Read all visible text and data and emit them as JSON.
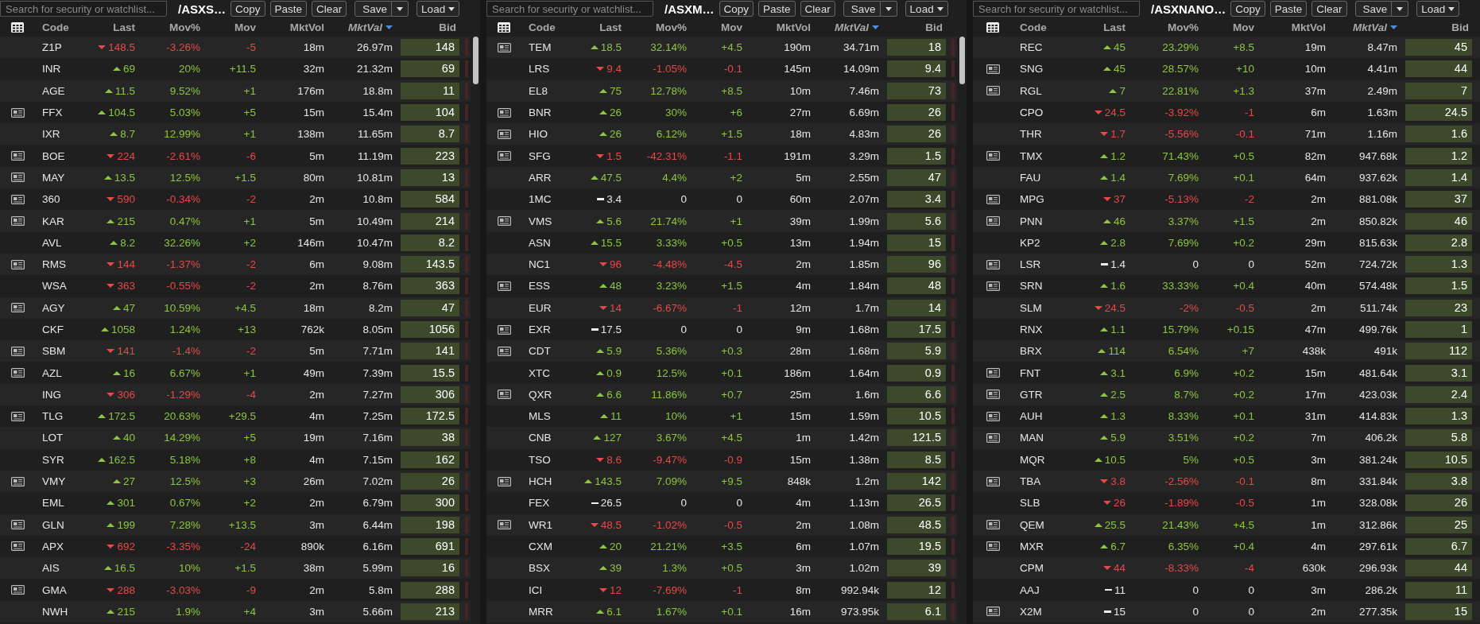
{
  "panels": [
    {
      "search": {
        "placeholder": "Search for security or watchlist..."
      },
      "title": "/ASXS…",
      "buttons": [
        {
          "label": "Copy",
          "kind": "plain"
        },
        {
          "label": "Paste",
          "kind": "plain"
        },
        {
          "label": "Clear",
          "kind": "plain"
        },
        {
          "label": "Save",
          "kind": "split"
        },
        {
          "label": "Load",
          "kind": "menu"
        }
      ],
      "columns": [
        {
          "label": "Code",
          "sorted": false
        },
        {
          "label": "Last",
          "sorted": false
        },
        {
          "label": "Mov%",
          "sorted": false
        },
        {
          "label": "Mov",
          "sorted": false
        },
        {
          "label": "MktVol",
          "sorted": false
        },
        {
          "label": "MktVal",
          "sorted": true
        },
        {
          "label": "Bid",
          "sorted": false
        }
      ],
      "rows": [
        {
          "news": false,
          "code": "Z1P",
          "last": "148.5",
          "kind": "down",
          "movpct": "-3.26%",
          "mov": "-5",
          "vol": "18m",
          "val": "26.97m",
          "bid": "148"
        },
        {
          "news": false,
          "code": "INR",
          "last": "69",
          "kind": "up",
          "movpct": "20%",
          "mov": "+11.5",
          "vol": "32m",
          "val": "21.32m",
          "bid": "69"
        },
        {
          "news": false,
          "code": "AGE",
          "last": "11.5",
          "kind": "up",
          "movpct": "9.52%",
          "mov": "+1",
          "vol": "176m",
          "val": "18.8m",
          "bid": "11"
        },
        {
          "news": true,
          "code": "FFX",
          "last": "104.5",
          "kind": "up",
          "movpct": "5.03%",
          "mov": "+5",
          "vol": "15m",
          "val": "15.4m",
          "bid": "104"
        },
        {
          "news": false,
          "code": "IXR",
          "last": "8.7",
          "kind": "up",
          "movpct": "12.99%",
          "mov": "+1",
          "vol": "138m",
          "val": "11.65m",
          "bid": "8.7"
        },
        {
          "news": true,
          "code": "BOE",
          "last": "224",
          "kind": "down",
          "movpct": "-2.61%",
          "mov": "-6",
          "vol": "5m",
          "val": "11.19m",
          "bid": "223"
        },
        {
          "news": true,
          "code": "MAY",
          "last": "13.5",
          "kind": "up",
          "movpct": "12.5%",
          "mov": "+1.5",
          "vol": "80m",
          "val": "10.81m",
          "bid": "13"
        },
        {
          "news": true,
          "code": "360",
          "last": "590",
          "kind": "down",
          "movpct": "-0.34%",
          "mov": "-2",
          "vol": "2m",
          "val": "10.8m",
          "bid": "584"
        },
        {
          "news": true,
          "code": "KAR",
          "last": "215",
          "kind": "up",
          "movpct": "0.47%",
          "mov": "+1",
          "vol": "5m",
          "val": "10.49m",
          "bid": "214"
        },
        {
          "news": false,
          "code": "AVL",
          "last": "8.2",
          "kind": "up",
          "movpct": "32.26%",
          "mov": "+2",
          "vol": "146m",
          "val": "10.47m",
          "bid": "8.2"
        },
        {
          "news": true,
          "code": "RMS",
          "last": "144",
          "kind": "down",
          "movpct": "-1.37%",
          "mov": "-2",
          "vol": "6m",
          "val": "9.08m",
          "bid": "143.5"
        },
        {
          "news": false,
          "code": "WSA",
          "last": "363",
          "kind": "down",
          "movpct": "-0.55%",
          "mov": "-2",
          "vol": "2m",
          "val": "8.76m",
          "bid": "363"
        },
        {
          "news": true,
          "code": "AGY",
          "last": "47",
          "kind": "up",
          "movpct": "10.59%",
          "mov": "+4.5",
          "vol": "18m",
          "val": "8.2m",
          "bid": "47"
        },
        {
          "news": false,
          "code": "CKF",
          "last": "1058",
          "kind": "up",
          "movpct": "1.24%",
          "mov": "+13",
          "vol": "762k",
          "val": "8.05m",
          "bid": "1056"
        },
        {
          "news": true,
          "code": "SBM",
          "last": "141",
          "kind": "down",
          "movpct": "-1.4%",
          "mov": "-2",
          "vol": "5m",
          "val": "7.71m",
          "bid": "141"
        },
        {
          "news": true,
          "code": "AZL",
          "last": "16",
          "kind": "up",
          "movpct": "6.67%",
          "mov": "+1",
          "vol": "49m",
          "val": "7.39m",
          "bid": "15.5"
        },
        {
          "news": false,
          "code": "ING",
          "last": "306",
          "kind": "down",
          "movpct": "-1.29%",
          "mov": "-4",
          "vol": "2m",
          "val": "7.27m",
          "bid": "306"
        },
        {
          "news": true,
          "code": "TLG",
          "last": "172.5",
          "kind": "up",
          "movpct": "20.63%",
          "mov": "+29.5",
          "vol": "4m",
          "val": "7.25m",
          "bid": "172.5"
        },
        {
          "news": false,
          "code": "LOT",
          "last": "40",
          "kind": "up",
          "movpct": "14.29%",
          "mov": "+5",
          "vol": "19m",
          "val": "7.16m",
          "bid": "38"
        },
        {
          "news": false,
          "code": "SYR",
          "last": "162.5",
          "kind": "up",
          "movpct": "5.18%",
          "mov": "+8",
          "vol": "4m",
          "val": "7.15m",
          "bid": "162"
        },
        {
          "news": true,
          "code": "VMY",
          "last": "27",
          "kind": "up",
          "movpct": "12.5%",
          "mov": "+3",
          "vol": "26m",
          "val": "7.02m",
          "bid": "26"
        },
        {
          "news": false,
          "code": "EML",
          "last": "301",
          "kind": "up",
          "movpct": "0.67%",
          "mov": "+2",
          "vol": "2m",
          "val": "6.79m",
          "bid": "300"
        },
        {
          "news": true,
          "code": "GLN",
          "last": "199",
          "kind": "up",
          "movpct": "7.28%",
          "mov": "+13.5",
          "vol": "3m",
          "val": "6.44m",
          "bid": "198"
        },
        {
          "news": true,
          "code": "APX",
          "last": "692",
          "kind": "down",
          "movpct": "-3.35%",
          "mov": "-24",
          "vol": "890k",
          "val": "6.16m",
          "bid": "691"
        },
        {
          "news": false,
          "code": "AIS",
          "last": "16.5",
          "kind": "up",
          "movpct": "10%",
          "mov": "+1.5",
          "vol": "38m",
          "val": "5.99m",
          "bid": "16"
        },
        {
          "news": true,
          "code": "GMA",
          "last": "288",
          "kind": "down",
          "movpct": "-3.03%",
          "mov": "-9",
          "vol": "2m",
          "val": "5.8m",
          "bid": "288"
        },
        {
          "news": false,
          "code": "NWH",
          "last": "215",
          "kind": "up",
          "movpct": "1.9%",
          "mov": "+4",
          "vol": "3m",
          "val": "5.66m",
          "bid": "213"
        }
      ]
    },
    {
      "search": {
        "placeholder": "Search for security or watchlist..."
      },
      "title": "/ASXM…",
      "buttons": [
        {
          "label": "Copy",
          "kind": "plain"
        },
        {
          "label": "Paste",
          "kind": "plain"
        },
        {
          "label": "Clear",
          "kind": "plain"
        },
        {
          "label": "Save",
          "kind": "split"
        },
        {
          "label": "Load",
          "kind": "menu"
        }
      ],
      "columns": [
        {
          "label": "Code",
          "sorted": false
        },
        {
          "label": "Last",
          "sorted": false
        },
        {
          "label": "Mov%",
          "sorted": false
        },
        {
          "label": "Mov",
          "sorted": false
        },
        {
          "label": "MktVol",
          "sorted": false
        },
        {
          "label": "MktVal",
          "sorted": true
        },
        {
          "label": "Bid",
          "sorted": false
        }
      ],
      "rows": [
        {
          "news": true,
          "code": "TEM",
          "last": "18.5",
          "kind": "up",
          "movpct": "32.14%",
          "mov": "+4.5",
          "vol": "190m",
          "val": "34.71m",
          "bid": "18"
        },
        {
          "news": false,
          "code": "LRS",
          "last": "9.4",
          "kind": "down",
          "movpct": "-1.05%",
          "mov": "-0.1",
          "vol": "145m",
          "val": "14.09m",
          "bid": "9.4"
        },
        {
          "news": false,
          "code": "EL8",
          "last": "75",
          "kind": "up",
          "movpct": "12.78%",
          "mov": "+8.5",
          "vol": "10m",
          "val": "7.46m",
          "bid": "73"
        },
        {
          "news": true,
          "code": "BNR",
          "last": "26",
          "kind": "up",
          "movpct": "30%",
          "mov": "+6",
          "vol": "27m",
          "val": "6.69m",
          "bid": "26"
        },
        {
          "news": true,
          "code": "HIO",
          "last": "26",
          "kind": "up",
          "movpct": "6.12%",
          "mov": "+1.5",
          "vol": "18m",
          "val": "4.83m",
          "bid": "26"
        },
        {
          "news": true,
          "code": "SFG",
          "last": "1.5",
          "kind": "down",
          "movpct": "-42.31%",
          "mov": "-1.1",
          "vol": "191m",
          "val": "3.29m",
          "bid": "1.5"
        },
        {
          "news": false,
          "code": "ARR",
          "last": "47.5",
          "kind": "up",
          "movpct": "4.4%",
          "mov": "+2",
          "vol": "5m",
          "val": "2.55m",
          "bid": "47"
        },
        {
          "news": false,
          "code": "1MC",
          "last": "3.4",
          "kind": "flat",
          "movpct": "0",
          "mov": "0",
          "vol": "60m",
          "val": "2.07m",
          "bid": "3.4"
        },
        {
          "news": true,
          "code": "VMS",
          "last": "5.6",
          "kind": "up",
          "movpct": "21.74%",
          "mov": "+1",
          "vol": "39m",
          "val": "1.99m",
          "bid": "5.6"
        },
        {
          "news": false,
          "code": "ASN",
          "last": "15.5",
          "kind": "up",
          "movpct": "3.33%",
          "mov": "+0.5",
          "vol": "13m",
          "val": "1.94m",
          "bid": "15"
        },
        {
          "news": false,
          "code": "NC1",
          "last": "96",
          "kind": "down",
          "movpct": "-4.48%",
          "mov": "-4.5",
          "vol": "2m",
          "val": "1.85m",
          "bid": "96"
        },
        {
          "news": true,
          "code": "ESS",
          "last": "48",
          "kind": "up",
          "movpct": "3.23%",
          "mov": "+1.5",
          "vol": "4m",
          "val": "1.84m",
          "bid": "48"
        },
        {
          "news": false,
          "code": "EUR",
          "last": "14",
          "kind": "down",
          "movpct": "-6.67%",
          "mov": "-1",
          "vol": "12m",
          "val": "1.7m",
          "bid": "14"
        },
        {
          "news": true,
          "code": "EXR",
          "last": "17.5",
          "kind": "flat",
          "movpct": "0",
          "mov": "0",
          "vol": "9m",
          "val": "1.68m",
          "bid": "17.5"
        },
        {
          "news": true,
          "code": "CDT",
          "last": "5.9",
          "kind": "up",
          "movpct": "5.36%",
          "mov": "+0.3",
          "vol": "28m",
          "val": "1.68m",
          "bid": "5.9"
        },
        {
          "news": false,
          "code": "XTC",
          "last": "0.9",
          "kind": "up",
          "movpct": "12.5%",
          "mov": "+0.1",
          "vol": "186m",
          "val": "1.64m",
          "bid": "0.9"
        },
        {
          "news": true,
          "code": "QXR",
          "last": "6.6",
          "kind": "up",
          "movpct": "11.86%",
          "mov": "+0.7",
          "vol": "25m",
          "val": "1.6m",
          "bid": "6.6"
        },
        {
          "news": false,
          "code": "MLS",
          "last": "11",
          "kind": "up",
          "movpct": "10%",
          "mov": "+1",
          "vol": "15m",
          "val": "1.59m",
          "bid": "10.5"
        },
        {
          "news": false,
          "code": "CNB",
          "last": "127",
          "kind": "up",
          "movpct": "3.67%",
          "mov": "+4.5",
          "vol": "1m",
          "val": "1.42m",
          "bid": "121.5"
        },
        {
          "news": false,
          "code": "TSO",
          "last": "8.6",
          "kind": "down",
          "movpct": "-9.47%",
          "mov": "-0.9",
          "vol": "15m",
          "val": "1.38m",
          "bid": "8.5"
        },
        {
          "news": true,
          "code": "HCH",
          "last": "143.5",
          "kind": "up",
          "movpct": "7.09%",
          "mov": "+9.5",
          "vol": "848k",
          "val": "1.2m",
          "bid": "142"
        },
        {
          "news": false,
          "code": "FEX",
          "last": "26.5",
          "kind": "flat",
          "movpct": "0",
          "mov": "0",
          "vol": "4m",
          "val": "1.13m",
          "bid": "26.5"
        },
        {
          "news": true,
          "code": "WR1",
          "last": "48.5",
          "kind": "down",
          "movpct": "-1.02%",
          "mov": "-0.5",
          "vol": "2m",
          "val": "1.08m",
          "bid": "48.5"
        },
        {
          "news": false,
          "code": "CXM",
          "last": "20",
          "kind": "up",
          "movpct": "21.21%",
          "mov": "+3.5",
          "vol": "6m",
          "val": "1.07m",
          "bid": "19.5"
        },
        {
          "news": false,
          "code": "BSX",
          "last": "39",
          "kind": "up",
          "movpct": "1.3%",
          "mov": "+0.5",
          "vol": "3m",
          "val": "1.02m",
          "bid": "39"
        },
        {
          "news": false,
          "code": "ICI",
          "last": "12",
          "kind": "down",
          "movpct": "-7.69%",
          "mov": "-1",
          "vol": "8m",
          "val": "992.94k",
          "bid": "12"
        },
        {
          "news": false,
          "code": "MRR",
          "last": "6.1",
          "kind": "up",
          "movpct": "1.67%",
          "mov": "+0.1",
          "vol": "16m",
          "val": "973.95k",
          "bid": "6.1"
        }
      ]
    },
    {
      "search": {
        "placeholder": "Search for security or watchlist..."
      },
      "title": "/ASXNANO…",
      "buttons": [
        {
          "label": "Copy",
          "kind": "plain"
        },
        {
          "label": "Paste",
          "kind": "plain"
        },
        {
          "label": "Clear",
          "kind": "plain"
        },
        {
          "label": "Save",
          "kind": "split"
        },
        {
          "label": "Load",
          "kind": "menu"
        }
      ],
      "columns": [
        {
          "label": "Code",
          "sorted": false
        },
        {
          "label": "Last",
          "sorted": false
        },
        {
          "label": "Mov%",
          "sorted": false
        },
        {
          "label": "Mov",
          "sorted": false
        },
        {
          "label": "MktVol",
          "sorted": false
        },
        {
          "label": "MktVal",
          "sorted": true
        },
        {
          "label": "Bid",
          "sorted": false
        }
      ],
      "rows": [
        {
          "news": false,
          "code": "REC",
          "last": "45",
          "kind": "up",
          "movpct": "23.29%",
          "mov": "+8.5",
          "vol": "19m",
          "val": "8.47m",
          "bid": "45"
        },
        {
          "news": true,
          "code": "SNG",
          "last": "45",
          "kind": "up",
          "movpct": "28.57%",
          "mov": "+10",
          "vol": "10m",
          "val": "4.41m",
          "bid": "44"
        },
        {
          "news": true,
          "code": "RGL",
          "last": "7",
          "kind": "up",
          "movpct": "22.81%",
          "mov": "+1.3",
          "vol": "37m",
          "val": "2.49m",
          "bid": "7"
        },
        {
          "news": false,
          "code": "CPO",
          "last": "24.5",
          "kind": "down",
          "movpct": "-3.92%",
          "mov": "-1",
          "vol": "6m",
          "val": "1.63m",
          "bid": "24.5"
        },
        {
          "news": false,
          "code": "THR",
          "last": "1.7",
          "kind": "down",
          "movpct": "-5.56%",
          "mov": "-0.1",
          "vol": "71m",
          "val": "1.16m",
          "bid": "1.6"
        },
        {
          "news": true,
          "code": "TMX",
          "last": "1.2",
          "kind": "up",
          "movpct": "71.43%",
          "mov": "+0.5",
          "vol": "82m",
          "val": "947.68k",
          "bid": "1.2"
        },
        {
          "news": false,
          "code": "FAU",
          "last": "1.4",
          "kind": "up",
          "movpct": "7.69%",
          "mov": "+0.1",
          "vol": "64m",
          "val": "937.62k",
          "bid": "1.4"
        },
        {
          "news": true,
          "code": "MPG",
          "last": "37",
          "kind": "down",
          "movpct": "-5.13%",
          "mov": "-2",
          "vol": "2m",
          "val": "881.08k",
          "bid": "37"
        },
        {
          "news": true,
          "code": "PNN",
          "last": "46",
          "kind": "up",
          "movpct": "3.37%",
          "mov": "+1.5",
          "vol": "2m",
          "val": "850.82k",
          "bid": "46"
        },
        {
          "news": false,
          "code": "KP2",
          "last": "2.8",
          "kind": "up",
          "movpct": "7.69%",
          "mov": "+0.2",
          "vol": "29m",
          "val": "815.63k",
          "bid": "2.8"
        },
        {
          "news": true,
          "code": "LSR",
          "last": "1.4",
          "kind": "flat",
          "movpct": "0",
          "mov": "0",
          "vol": "52m",
          "val": "724.72k",
          "bid": "1.3"
        },
        {
          "news": true,
          "code": "SRN",
          "last": "1.6",
          "kind": "up",
          "movpct": "33.33%",
          "mov": "+0.4",
          "vol": "40m",
          "val": "574.48k",
          "bid": "1.5"
        },
        {
          "news": false,
          "code": "SLM",
          "last": "24.5",
          "kind": "down",
          "movpct": "-2%",
          "mov": "-0.5",
          "vol": "2m",
          "val": "511.74k",
          "bid": "23"
        },
        {
          "news": false,
          "code": "RNX",
          "last": "1.1",
          "kind": "up",
          "movpct": "15.79%",
          "mov": "+0.15",
          "vol": "47m",
          "val": "499.76k",
          "bid": "1"
        },
        {
          "news": false,
          "code": "BRX",
          "last": "114",
          "kind": "up",
          "movpct": "6.54%",
          "mov": "+7",
          "vol": "438k",
          "val": "491k",
          "bid": "112"
        },
        {
          "news": true,
          "code": "FNT",
          "last": "3.1",
          "kind": "up",
          "movpct": "6.9%",
          "mov": "+0.2",
          "vol": "15m",
          "val": "481.64k",
          "bid": "3.1"
        },
        {
          "news": true,
          "code": "GTR",
          "last": "2.5",
          "kind": "up",
          "movpct": "8.7%",
          "mov": "+0.2",
          "vol": "17m",
          "val": "423.03k",
          "bid": "2.4"
        },
        {
          "news": true,
          "code": "AUH",
          "last": "1.3",
          "kind": "up",
          "movpct": "8.33%",
          "mov": "+0.1",
          "vol": "31m",
          "val": "414.83k",
          "bid": "1.3"
        },
        {
          "news": true,
          "code": "MAN",
          "last": "5.9",
          "kind": "up",
          "movpct": "3.51%",
          "mov": "+0.2",
          "vol": "7m",
          "val": "406.2k",
          "bid": "5.8"
        },
        {
          "news": false,
          "code": "MQR",
          "last": "10.5",
          "kind": "up",
          "movpct": "5%",
          "mov": "+0.5",
          "vol": "3m",
          "val": "381.24k",
          "bid": "10.5"
        },
        {
          "news": true,
          "code": "TBA",
          "last": "3.8",
          "kind": "down",
          "movpct": "-2.56%",
          "mov": "-0.1",
          "vol": "8m",
          "val": "331.84k",
          "bid": "3.8"
        },
        {
          "news": false,
          "code": "SLB",
          "last": "26",
          "kind": "down",
          "movpct": "-1.89%",
          "mov": "-0.5",
          "vol": "1m",
          "val": "328.08k",
          "bid": "26"
        },
        {
          "news": true,
          "code": "QEM",
          "last": "25.5",
          "kind": "up",
          "movpct": "21.43%",
          "mov": "+4.5",
          "vol": "1m",
          "val": "312.86k",
          "bid": "25"
        },
        {
          "news": true,
          "code": "MXR",
          "last": "6.7",
          "kind": "up",
          "movpct": "6.35%",
          "mov": "+0.4",
          "vol": "4m",
          "val": "297.61k",
          "bid": "6.7"
        },
        {
          "news": false,
          "code": "CPM",
          "last": "44",
          "kind": "down",
          "movpct": "-8.33%",
          "mov": "-4",
          "vol": "630k",
          "val": "296.93k",
          "bid": "44"
        },
        {
          "news": false,
          "code": "AAJ",
          "last": "11",
          "kind": "flat",
          "movpct": "0",
          "mov": "0",
          "vol": "3m",
          "val": "286.2k",
          "bid": "11"
        },
        {
          "news": true,
          "code": "X2M",
          "last": "15",
          "kind": "flat",
          "movpct": "0",
          "mov": "0",
          "vol": "2m",
          "val": "277.35k",
          "bid": "15"
        }
      ]
    }
  ]
}
